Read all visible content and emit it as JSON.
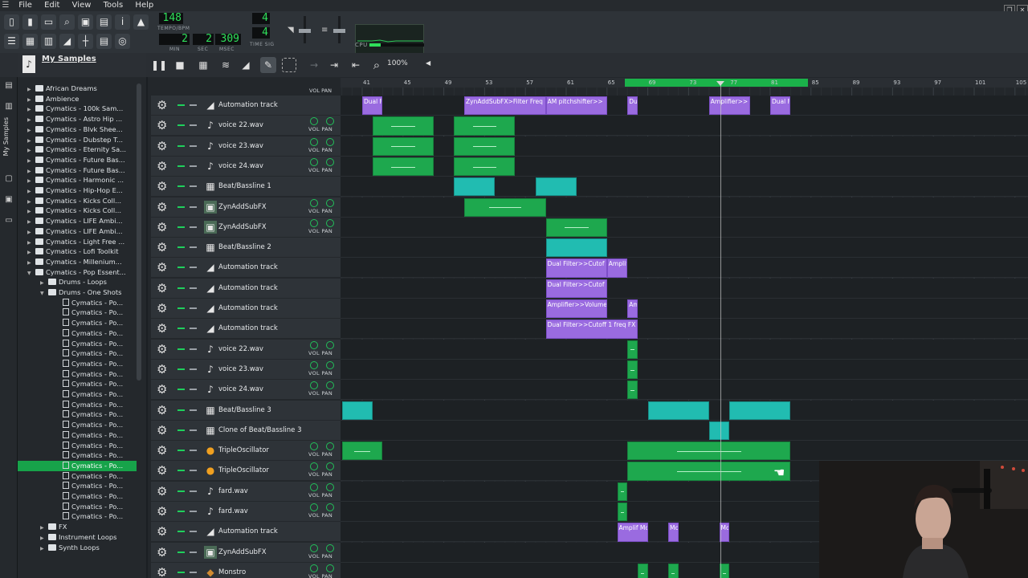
{
  "menu": {
    "items": [
      "File",
      "Edit",
      "View",
      "Tools",
      "Help"
    ]
  },
  "transport": {
    "tempo": "148",
    "tempo_label": "TEMPO/BPM",
    "time_min": "2",
    "time_sec": "2",
    "time_msec": "309",
    "min_label": "MIN",
    "sec_label": "SEC",
    "msec_label": "MSEC",
    "timesig_num": "4",
    "timesig_den": "4",
    "timesig_label": "TIME SIG",
    "cpu_label": "CPU"
  },
  "song_editor": {
    "zoom": "100%",
    "ruler_labels": [
      "41",
      "45",
      "49",
      "53",
      "57",
      "61",
      "65",
      "69",
      "73",
      "77",
      "81",
      "85",
      "89",
      "93",
      "97",
      "101",
      "105"
    ],
    "vol_pan_label": "VOL PAN"
  },
  "sidebar": {
    "title": "My Samples",
    "vertical_label": "My Samples"
  },
  "browser": {
    "items": [
      {
        "label": "African Dreams",
        "level": 0,
        "kind": "folder"
      },
      {
        "label": "Ambience",
        "level": 0,
        "kind": "folder"
      },
      {
        "label": "Cymatics - 100k Sam...",
        "level": 0,
        "kind": "folder"
      },
      {
        "label": "Cymatics - Astro Hip ...",
        "level": 0,
        "kind": "folder"
      },
      {
        "label": "Cymatics - Blvk Shee...",
        "level": 0,
        "kind": "folder"
      },
      {
        "label": "Cymatics - Dubstep T...",
        "level": 0,
        "kind": "folder"
      },
      {
        "label": "Cymatics - Eternity Sa...",
        "level": 0,
        "kind": "folder"
      },
      {
        "label": "Cymatics - Future Bas...",
        "level": 0,
        "kind": "folder"
      },
      {
        "label": "Cymatics - Future Bas...",
        "level": 0,
        "kind": "folder"
      },
      {
        "label": "Cymatics - Harmonic ...",
        "level": 0,
        "kind": "folder"
      },
      {
        "label": "Cymatics - Hip-Hop E...",
        "level": 0,
        "kind": "folder"
      },
      {
        "label": "Cymatics - Kicks Coll...",
        "level": 0,
        "kind": "folder"
      },
      {
        "label": "Cymatics - Kicks Coll...",
        "level": 0,
        "kind": "folder"
      },
      {
        "label": "Cymatics - LIFE Ambi...",
        "level": 0,
        "kind": "folder"
      },
      {
        "label": "Cymatics - LIFE Ambi...",
        "level": 0,
        "kind": "folder"
      },
      {
        "label": "Cymatics - Light Free ...",
        "level": 0,
        "kind": "folder"
      },
      {
        "label": "Cymatics - Lofi Toolkit",
        "level": 0,
        "kind": "folder"
      },
      {
        "label": "Cymatics - Millenium...",
        "level": 0,
        "kind": "folder"
      },
      {
        "label": "Cymatics - Pop Essent...",
        "level": 0,
        "kind": "folder",
        "open": true
      },
      {
        "label": "Drums - Loops",
        "level": 1,
        "kind": "folder"
      },
      {
        "label": "Drums - One Shots",
        "level": 1,
        "kind": "folder",
        "open": true
      },
      {
        "label": "Cymatics - Po...",
        "level": 2,
        "kind": "file"
      },
      {
        "label": "Cymatics - Po...",
        "level": 2,
        "kind": "file"
      },
      {
        "label": "Cymatics - Po...",
        "level": 2,
        "kind": "file"
      },
      {
        "label": "Cymatics - Po...",
        "level": 2,
        "kind": "file"
      },
      {
        "label": "Cymatics - Po...",
        "level": 2,
        "kind": "file"
      },
      {
        "label": "Cymatics - Po...",
        "level": 2,
        "kind": "file"
      },
      {
        "label": "Cymatics - Po...",
        "level": 2,
        "kind": "file"
      },
      {
        "label": "Cymatics - Po...",
        "level": 2,
        "kind": "file"
      },
      {
        "label": "Cymatics - Po...",
        "level": 2,
        "kind": "file"
      },
      {
        "label": "Cymatics - Po...",
        "level": 2,
        "kind": "file"
      },
      {
        "label": "Cymatics - Po...",
        "level": 2,
        "kind": "file"
      },
      {
        "label": "Cymatics - Po...",
        "level": 2,
        "kind": "file"
      },
      {
        "label": "Cymatics - Po...",
        "level": 2,
        "kind": "file"
      },
      {
        "label": "Cymatics - Po...",
        "level": 2,
        "kind": "file"
      },
      {
        "label": "Cymatics - Po...",
        "level": 2,
        "kind": "file"
      },
      {
        "label": "Cymatics - Po...",
        "level": 2,
        "kind": "file"
      },
      {
        "label": "Cymatics - Po...",
        "level": 2,
        "kind": "file",
        "selected": true
      },
      {
        "label": "Cymatics - Po...",
        "level": 2,
        "kind": "file"
      },
      {
        "label": "Cymatics - Po...",
        "level": 2,
        "kind": "file"
      },
      {
        "label": "Cymatics - Po...",
        "level": 2,
        "kind": "file"
      },
      {
        "label": "Cymatics - Po...",
        "level": 2,
        "kind": "file"
      },
      {
        "label": "Cymatics - Po...",
        "level": 2,
        "kind": "file"
      },
      {
        "label": "FX",
        "level": 1,
        "kind": "folder"
      },
      {
        "label": "Instrument Loops",
        "level": 1,
        "kind": "folder"
      },
      {
        "label": "Synth Loops",
        "level": 1,
        "kind": "folder"
      }
    ]
  },
  "tracks": [
    {
      "name": "Automation track",
      "type": "automation",
      "vol_pan": false
    },
    {
      "name": "voice 22.wav",
      "type": "sample",
      "vol_pan": true
    },
    {
      "name": "voice 23.wav",
      "type": "sample",
      "vol_pan": true
    },
    {
      "name": "voice 24.wav",
      "type": "sample",
      "vol_pan": true
    },
    {
      "name": "Beat/Bassline 1",
      "type": "beat",
      "vol_pan": false
    },
    {
      "name": "ZynAddSubFX",
      "type": "instrument",
      "vol_pan": true
    },
    {
      "name": "ZynAddSubFX",
      "type": "instrument",
      "vol_pan": true
    },
    {
      "name": "Beat/Bassline 2",
      "type": "beat",
      "vol_pan": false
    },
    {
      "name": "Automation track",
      "type": "automation",
      "vol_pan": false
    },
    {
      "name": "Automation track",
      "type": "automation",
      "vol_pan": false
    },
    {
      "name": "Automation track",
      "type": "automation",
      "vol_pan": false
    },
    {
      "name": "Automation track",
      "type": "automation",
      "vol_pan": false
    },
    {
      "name": "voice 22.wav",
      "type": "sample",
      "vol_pan": true
    },
    {
      "name": "voice 23.wav",
      "type": "sample",
      "vol_pan": true
    },
    {
      "name": "voice 24.wav",
      "type": "sample",
      "vol_pan": true
    },
    {
      "name": "Beat/Bassline 3",
      "type": "beat",
      "vol_pan": false
    },
    {
      "name": "Clone of Beat/Bassline 3",
      "type": "beat",
      "vol_pan": false
    },
    {
      "name": "TripleOscillator",
      "type": "triple",
      "vol_pan": true
    },
    {
      "name": "TripleOscillator",
      "type": "triple",
      "vol_pan": true
    },
    {
      "name": "fard.wav",
      "type": "sample",
      "vol_pan": true
    },
    {
      "name": "fard.wav",
      "type": "sample",
      "vol_pan": true
    },
    {
      "name": "Automation track",
      "type": "automation",
      "vol_pan": false
    },
    {
      "name": "ZynAddSubFX",
      "type": "instrument",
      "vol_pan": true
    },
    {
      "name": "Monstro",
      "type": "monstro",
      "vol_pan": true
    }
  ],
  "clips": [
    {
      "track": 0,
      "start": 41,
      "end": 43,
      "kind": "aut",
      "label": "Dual F"
    },
    {
      "track": 0,
      "start": 51,
      "end": 59,
      "kind": "aut",
      "label": "ZynAddSubFX>Filter Freq"
    },
    {
      "track": 0,
      "start": 59,
      "end": 65,
      "kind": "aut",
      "label": "AM pitchshifter>>"
    },
    {
      "track": 0,
      "start": 67,
      "end": 68,
      "kind": "aut",
      "label": "Du"
    },
    {
      "track": 0,
      "start": 75,
      "end": 79,
      "kind": "aut",
      "label": "Amplifier>>"
    },
    {
      "track": 0,
      "start": 81,
      "end": 83,
      "kind": "aut",
      "label": "Dual F"
    },
    {
      "track": 1,
      "start": 42,
      "end": 48,
      "kind": "smp",
      "label": ""
    },
    {
      "track": 1,
      "start": 50,
      "end": 56,
      "kind": "smp",
      "label": ""
    },
    {
      "track": 2,
      "start": 42,
      "end": 48,
      "kind": "smp",
      "label": ""
    },
    {
      "track": 2,
      "start": 50,
      "end": 56,
      "kind": "smp",
      "label": ""
    },
    {
      "track": 3,
      "start": 42,
      "end": 48,
      "kind": "smp",
      "label": ""
    },
    {
      "track": 3,
      "start": 50,
      "end": 56,
      "kind": "smp",
      "label": ""
    },
    {
      "track": 4,
      "start": 50,
      "end": 54,
      "kind": "bb",
      "label": ""
    },
    {
      "track": 4,
      "start": 58,
      "end": 62,
      "kind": "bb",
      "label": ""
    },
    {
      "track": 5,
      "start": 51,
      "end": 59,
      "kind": "smp",
      "label": ""
    },
    {
      "track": 6,
      "start": 59,
      "end": 65,
      "kind": "smp",
      "label": ""
    },
    {
      "track": 7,
      "start": 59,
      "end": 65,
      "kind": "bb",
      "label": ""
    },
    {
      "track": 8,
      "start": 59,
      "end": 65,
      "kind": "aut",
      "label": "Dual Filter>>Cutof"
    },
    {
      "track": 8,
      "start": 65,
      "end": 67,
      "kind": "aut",
      "label": "Amplif"
    },
    {
      "track": 9,
      "start": 59,
      "end": 65,
      "kind": "aut",
      "label": "Dual Filter>>Cutof"
    },
    {
      "track": 10,
      "start": 59,
      "end": 65,
      "kind": "aut",
      "label": "Amplifier>>Volume"
    },
    {
      "track": 10,
      "start": 67,
      "end": 68,
      "kind": "aut",
      "label": "Am"
    },
    {
      "track": 11,
      "start": 59,
      "end": 68,
      "kind": "aut",
      "label": "Dual Filter>>Cutoff 1 freq FX"
    },
    {
      "track": 12,
      "start": 67,
      "end": 68,
      "kind": "smp",
      "label": ""
    },
    {
      "track": 13,
      "start": 67,
      "end": 68,
      "kind": "smp",
      "label": ""
    },
    {
      "track": 14,
      "start": 67,
      "end": 68,
      "kind": "smp",
      "label": ""
    },
    {
      "track": 15,
      "start": 39,
      "end": 42,
      "kind": "bb",
      "label": ""
    },
    {
      "track": 15,
      "start": 69,
      "end": 75,
      "kind": "bb",
      "label": ""
    },
    {
      "track": 15,
      "start": 77,
      "end": 83,
      "kind": "bb",
      "label": ""
    },
    {
      "track": 16,
      "start": 75,
      "end": 77,
      "kind": "bb",
      "label": ""
    },
    {
      "track": 17,
      "start": 39,
      "end": 43,
      "kind": "smp",
      "label": ""
    },
    {
      "track": 17,
      "start": 67,
      "end": 83,
      "kind": "smp",
      "label": ""
    },
    {
      "track": 18,
      "start": 67,
      "end": 83,
      "kind": "smp",
      "label": ""
    },
    {
      "track": 19,
      "start": 66,
      "end": 67,
      "kind": "smp",
      "label": ""
    },
    {
      "track": 20,
      "start": 66,
      "end": 67,
      "kind": "smp",
      "label": ""
    },
    {
      "track": 21,
      "start": 66,
      "end": 69,
      "kind": "aut",
      "label": "Amplif Mc"
    },
    {
      "track": 21,
      "start": 71,
      "end": 72,
      "kind": "aut",
      "label": "Mc"
    },
    {
      "track": 21,
      "start": 76,
      "end": 77,
      "kind": "aut",
      "label": "Mc"
    },
    {
      "track": 23,
      "start": 68,
      "end": 69,
      "kind": "smp",
      "label": ""
    },
    {
      "track": 23,
      "start": 71,
      "end": 72,
      "kind": "smp",
      "label": ""
    },
    {
      "track": 23,
      "start": 76,
      "end": 77,
      "kind": "smp",
      "label": ""
    }
  ],
  "colors": {
    "accent_green": "#1ea84e",
    "automation_purple": "#9a6be0",
    "beat_cyan": "#21bcb1",
    "lcd_green": "#2fe05a"
  }
}
